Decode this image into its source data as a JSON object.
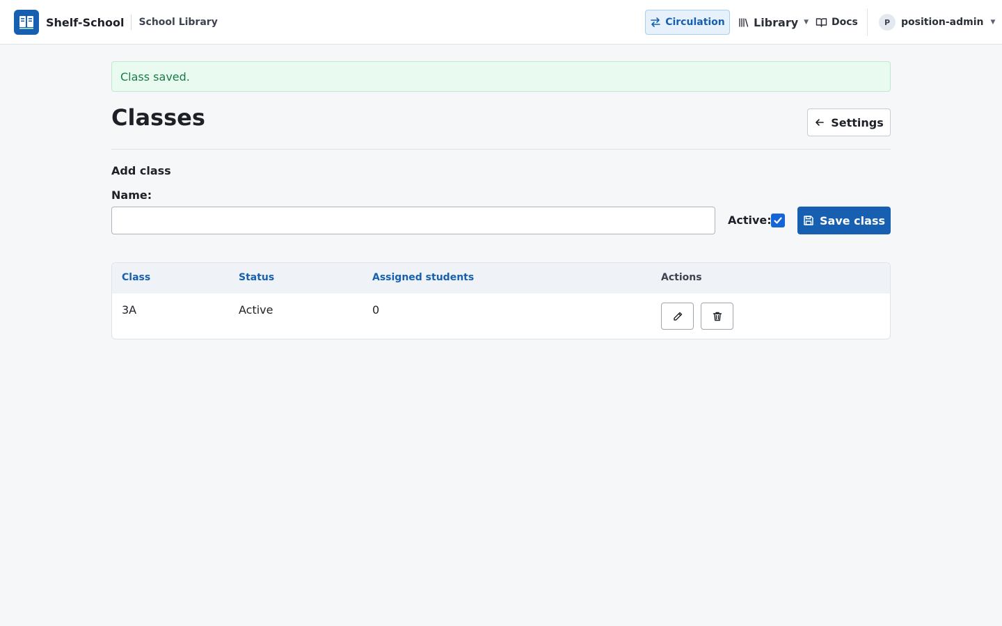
{
  "brand": {
    "name": "Shelf-School",
    "subtitle": "School Library"
  },
  "nav": {
    "circulation": "Circulation",
    "library": "Library",
    "docs": "Docs",
    "user_initial": "P",
    "user_name": "position-admin"
  },
  "alert": {
    "message": "Class saved."
  },
  "page": {
    "title": "Classes",
    "settings_button": "Settings"
  },
  "form": {
    "section_title": "Add class",
    "name_label": "Name:",
    "name_value": "",
    "active_label": "Active:",
    "active_checked": true,
    "save_button": "Save class"
  },
  "table": {
    "columns": [
      "Class",
      "Status",
      "Assigned students",
      "Actions"
    ],
    "rows": [
      {
        "class": "3A",
        "status": "Active",
        "assigned_students": "0"
      }
    ]
  },
  "colors": {
    "primary": "#1760b1",
    "success_bg": "#e9fbf0",
    "success_text": "#1d7a46",
    "page_bg": "#f6f7f9"
  }
}
